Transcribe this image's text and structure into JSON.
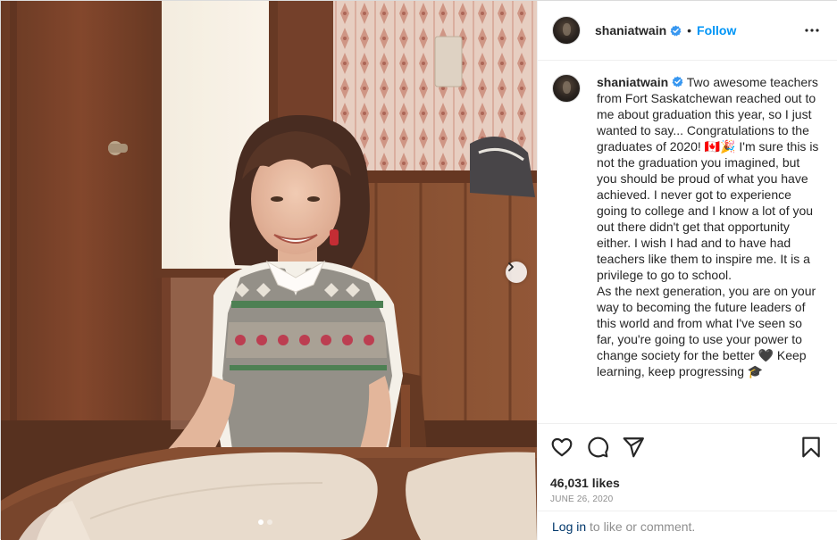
{
  "post": {
    "image_alt": "Vintage photo of a smiling young woman in a sweater vest sitting at a table",
    "carousel": {
      "slide_count": 2,
      "active_index": 0
    }
  },
  "header": {
    "username": "shaniatwain",
    "separator": "•",
    "follow_label": "Follow",
    "more_icon": "more-horizontal-icon"
  },
  "caption": {
    "username": "shaniatwain",
    "paragraph1": "Two awesome teachers from Fort Saskatchewan reached out to me about graduation this year, so I just wanted to say... Congratulations to the graduates of 2020! 🇨🇦🎉 I'm sure this is not the graduation you imagined, but you should be proud of what you have achieved. I never got to experience going to college and I know a lot of you out there didn't get that opportunity either. I wish I had and to have had teachers like them to inspire me. It is a privilege to go to school.",
    "paragraph2": "As the next generation, you are on your way to becoming the future leaders of this world and from what I've seen so far, you're going to use your power to change society for the better 🖤 Keep learning, keep progressing 🎓"
  },
  "actions": {
    "like_icon": "heart-icon",
    "comment_icon": "comment-icon",
    "share_icon": "share-icon",
    "save_icon": "bookmark-icon"
  },
  "likes_text": "46,031 likes",
  "date_text": "June 26, 2020",
  "login": {
    "link_label": "Log in",
    "rest_text": " to like or comment."
  },
  "colors": {
    "accent": "#0095f6",
    "verified": "#3897f0",
    "text": "#262626",
    "muted": "#8e8e8e"
  }
}
